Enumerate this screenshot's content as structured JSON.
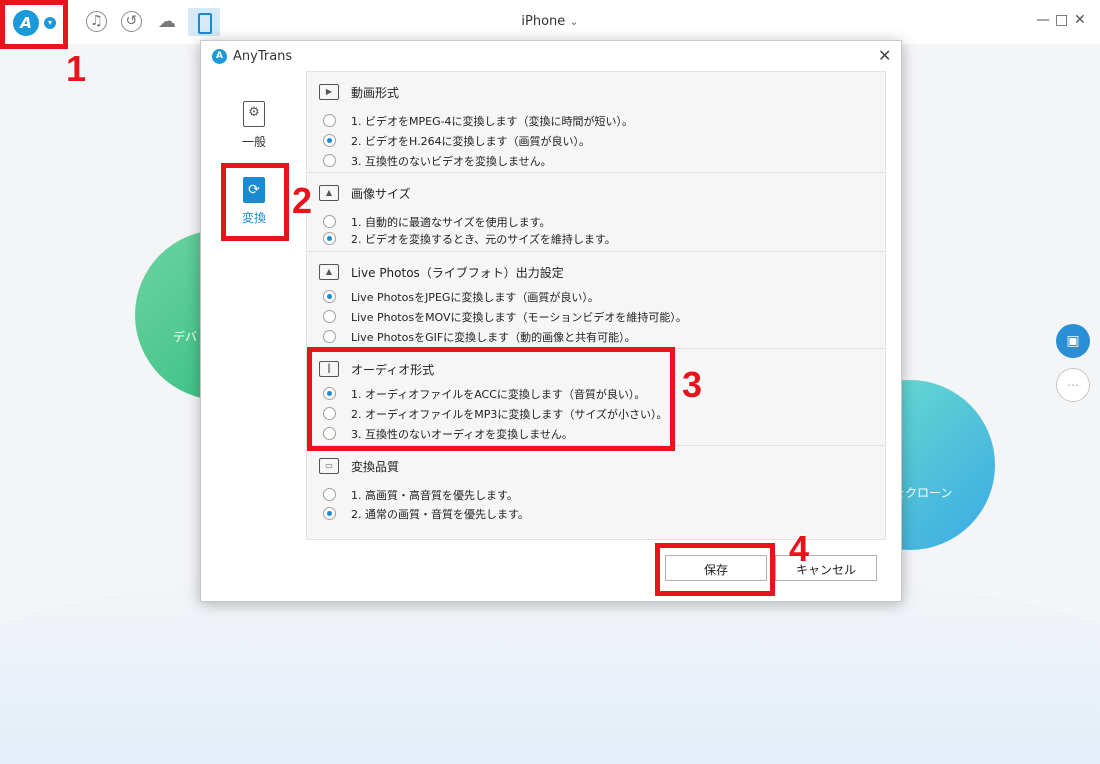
{
  "titlebar": {
    "device_name": "iPhone",
    "device_caret": "⌄",
    "window_controls": {
      "minimize": "—",
      "maximize": "□",
      "close": "✕"
    }
  },
  "background": {
    "left_circle_label": "デバ",
    "right_circle_label": "スをクローン"
  },
  "dialog": {
    "title": "AnyTrans",
    "close_label": "✕",
    "nav": [
      {
        "label": "一般"
      },
      {
        "label": "変換"
      }
    ],
    "sections": [
      {
        "title": "動画形式",
        "options": [
          {
            "label": "1. ビデオをMPEG-4に変換します（変換に時間が短い）。",
            "selected": false
          },
          {
            "label": "2. ビデオをH.264に変換します（画質が良い）。",
            "selected": true
          },
          {
            "label": "3. 互換性のないビデオを変換しません。",
            "selected": false
          }
        ]
      },
      {
        "title": "画像サイズ",
        "options": [
          {
            "label": "1. 自動的に最適なサイズを使用します。",
            "selected": false
          },
          {
            "label": "2. ビデオを変換するとき、元のサイズを維持します。",
            "selected": true
          }
        ]
      },
      {
        "title": "Live Photos（ライブフォト）出力設定",
        "options": [
          {
            "label": "Live PhotosをJPEGに変換します（画質が良い）。",
            "selected": true
          },
          {
            "label": "Live PhotosをMOVに変換します（モーションビデオを維持可能）。",
            "selected": false
          },
          {
            "label": "Live PhotosをGIFに変換します（動的画像と共有可能）。",
            "selected": false
          }
        ]
      },
      {
        "title": "オーディオ形式",
        "options": [
          {
            "label": "1. オーディオファイルをACCに変換します（音質が良い）。",
            "selected": true
          },
          {
            "label": "2. オーディオファイルをMP3に変換します（サイズが小さい）。",
            "selected": false
          },
          {
            "label": "3. 互換性のないオーディオを変換しません。",
            "selected": false
          }
        ]
      },
      {
        "title": "変換品質",
        "options": [
          {
            "label": "1. 高画質・高音質を優先します。",
            "selected": false
          },
          {
            "label": "2. 通常の画質・音質を優先します。",
            "selected": true
          }
        ]
      }
    ],
    "save_label": "保存",
    "cancel_label": "キャンセル"
  },
  "annotations": {
    "step1": "1",
    "step2": "2",
    "step3": "3",
    "step4": "4"
  },
  "colors": {
    "accent": "#1a8bd3",
    "annotation_red": "#e8131b"
  }
}
